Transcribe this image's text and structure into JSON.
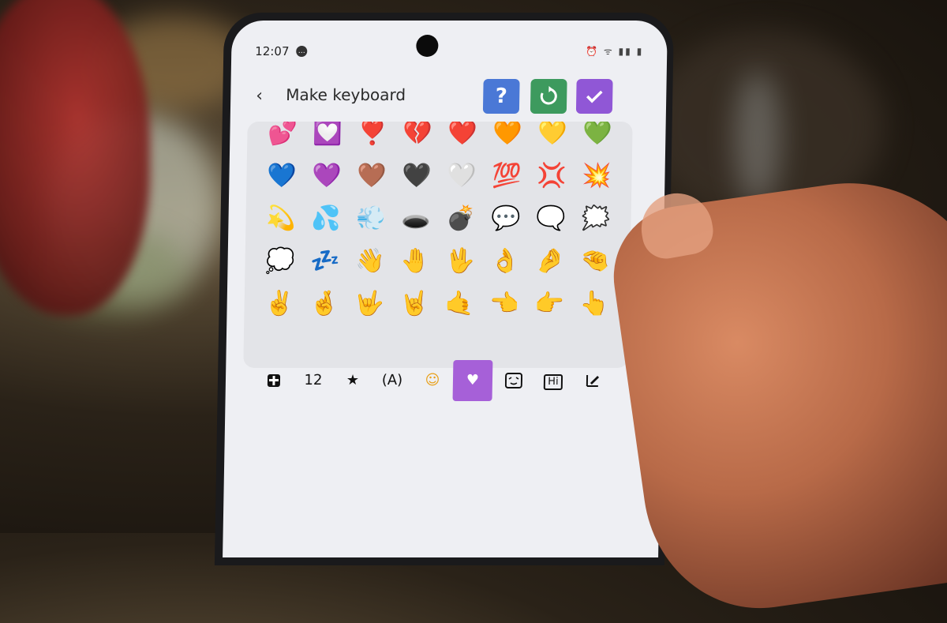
{
  "status_bar": {
    "time": "12:07",
    "icons": [
      "alarm-icon",
      "wifi-icon",
      "signal-icon",
      "battery-icon"
    ]
  },
  "header": {
    "back_icon": "chevron-left-icon",
    "title": "Make keyboard",
    "help_label": "?",
    "reset_icon": "refresh-icon",
    "confirm_icon": "check-icon",
    "colors": {
      "help": "#4a78d6",
      "reset": "#3d9a5e",
      "confirm": "#9057d6"
    }
  },
  "emoji_grid": [
    "💕",
    "💟",
    "❣️",
    "💔",
    "❤️",
    "🧡",
    "💛",
    "💚",
    "💙",
    "💜",
    "🤎",
    "🖤",
    "🤍",
    "💯",
    "💢",
    "💥",
    "💫",
    "💦",
    "💨",
    "🕳️",
    "💣",
    "💬",
    "🗨️",
    "🗯️",
    "💭",
    "💤",
    "👋",
    "🤚",
    "🖖",
    "👌",
    "🤌",
    "🤏",
    "✌️",
    "🤞",
    "🤟",
    "🤘",
    "🤙",
    "👈",
    "👉",
    "👆"
  ],
  "tabs": [
    {
      "name": "tab-plus",
      "label": "",
      "icon": "plus-box-icon"
    },
    {
      "name": "tab-numbers",
      "label": "12"
    },
    {
      "name": "tab-favorites",
      "label": "★"
    },
    {
      "name": "tab-letters",
      "label": "(A)"
    },
    {
      "name": "tab-emoji",
      "label": "☺"
    },
    {
      "name": "tab-heart",
      "label": "♥",
      "active": true
    },
    {
      "name": "tab-kaomoji",
      "label": ""
    },
    {
      "name": "tab-hi",
      "label": "Hi"
    },
    {
      "name": "tab-edit",
      "label": ""
    }
  ],
  "accent_color": "#a660d8"
}
